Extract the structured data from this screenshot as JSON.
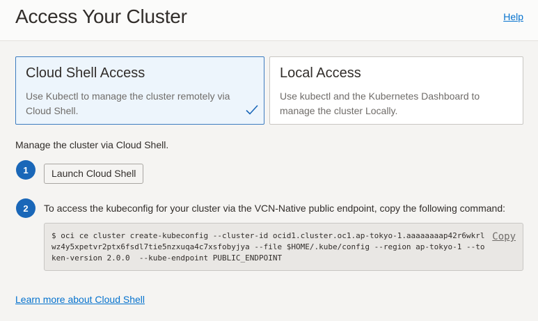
{
  "header": {
    "title": "Access Your Cluster",
    "help_label": "Help"
  },
  "access_options": [
    {
      "title": "Cloud Shell Access",
      "description": "Use Kubectl to manage the cluster remotely via Cloud Shell.",
      "selected": true
    },
    {
      "title": "Local Access",
      "description": "Use kubectl and the Kubernetes Dashboard to manage the cluster Locally.",
      "selected": false
    }
  ],
  "intro_text": "Manage the cluster via Cloud Shell.",
  "steps": [
    {
      "number": "1",
      "button_label": "Launch Cloud Shell"
    },
    {
      "number": "2",
      "text": "To access the kubeconfig for your cluster via the VCN-Native public endpoint, copy the following command:",
      "command": "$ oci ce cluster create-kubeconfig --cluster-id ocid1.cluster.oc1.ap-tokyo-1.aaaaaaaap42r6wkrl\nwz4y5xpetvr2ptx6fsdl7tie5nzxuqa4c7xsfobyjya --file $HOME/.kube/config --region ap-tokyo-1 --to\nken-version 2.0.0  --kube-endpoint PUBLIC_ENDPOINT",
      "copy_label": "Copy"
    }
  ],
  "learn_more_label": "Learn more about Cloud Shell",
  "icons": {
    "selected_check": "checkmark-icon"
  },
  "colors": {
    "accent": "#1a67b8",
    "link": "#0572ce",
    "selected_border": "#3c7bbf",
    "selected_bg": "#edf5fc"
  }
}
